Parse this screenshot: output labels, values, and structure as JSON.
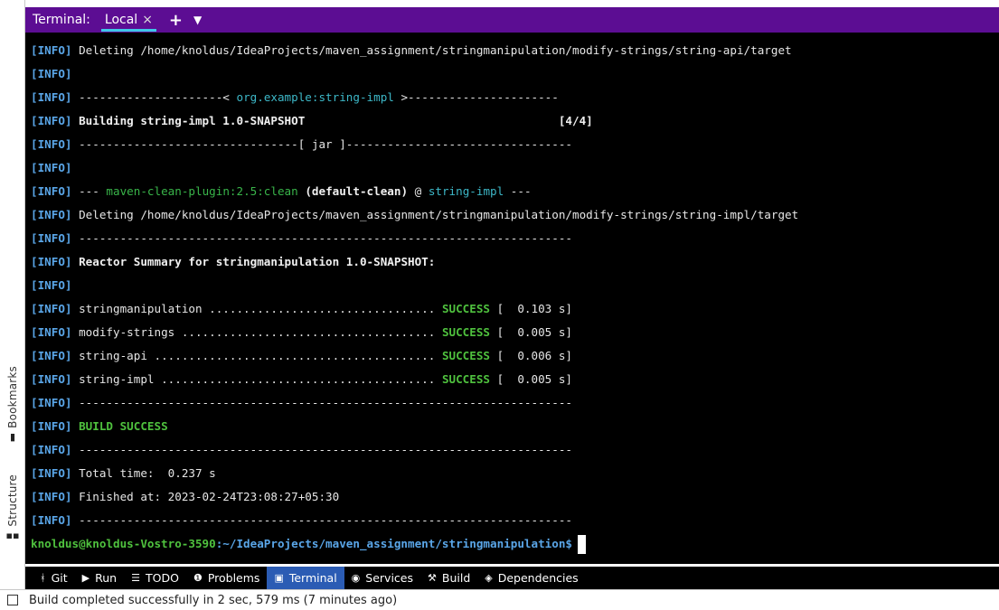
{
  "left_strip": {
    "bookmarks_label": "Bookmarks",
    "structure_label": "Structure"
  },
  "terminal": {
    "title": "Terminal:",
    "tab_label": "Local",
    "close_glyph": "×",
    "add_glyph": "+",
    "dropdown_glyph": "⌄"
  },
  "lines": [
    [
      {
        "t": "[INFO]",
        "c": "info"
      },
      {
        "t": " Deleting /home/knoldus/IdeaProjects/maven_assignment/stringmanipulation/modify-strings/string-api/target"
      }
    ],
    [
      {
        "t": "[INFO]",
        "c": "info"
      }
    ],
    [
      {
        "t": "[INFO]",
        "c": "info"
      },
      {
        "t": " ---------------------< "
      },
      {
        "t": "org.example:string-impl",
        "c": "art"
      },
      {
        "t": " >----------------------"
      }
    ],
    [
      {
        "t": "[INFO]",
        "c": "info"
      },
      {
        "t": " Building string-impl 1.0-SNAPSHOT                                     [4/4]",
        "c": "bold"
      }
    ],
    [
      {
        "t": "[INFO]",
        "c": "info"
      },
      {
        "t": " --------------------------------[ jar ]---------------------------------"
      }
    ],
    [
      {
        "t": "[INFO]",
        "c": "info"
      }
    ],
    [
      {
        "t": "[INFO]",
        "c": "info"
      },
      {
        "t": " --- "
      },
      {
        "t": "maven-clean-plugin:2.5:clean",
        "c": "plg"
      },
      {
        "t": " (default-clean)",
        "c": "bold"
      },
      {
        "t": " @ "
      },
      {
        "t": "string-impl",
        "c": "art"
      },
      {
        "t": " ---"
      }
    ],
    [
      {
        "t": "[INFO]",
        "c": "info"
      },
      {
        "t": " Deleting /home/knoldus/IdeaProjects/maven_assignment/stringmanipulation/modify-strings/string-impl/target"
      }
    ],
    [
      {
        "t": "[INFO]",
        "c": "info"
      },
      {
        "t": " ------------------------------------------------------------------------"
      }
    ],
    [
      {
        "t": "[INFO]",
        "c": "info"
      },
      {
        "t": " Reactor Summary for stringmanipulation 1.0-SNAPSHOT:",
        "c": "bold"
      }
    ],
    [
      {
        "t": "[INFO]",
        "c": "info"
      }
    ],
    [
      {
        "t": "[INFO]",
        "c": "info"
      },
      {
        "t": " stringmanipulation ................................. "
      },
      {
        "t": "SUCCESS",
        "c": "succ"
      },
      {
        "t": " [  0.103 s]"
      }
    ],
    [
      {
        "t": "[INFO]",
        "c": "info"
      },
      {
        "t": " modify-strings ..................................... "
      },
      {
        "t": "SUCCESS",
        "c": "succ"
      },
      {
        "t": " [  0.005 s]"
      }
    ],
    [
      {
        "t": "[INFO]",
        "c": "info"
      },
      {
        "t": " string-api ......................................... "
      },
      {
        "t": "SUCCESS",
        "c": "succ"
      },
      {
        "t": " [  0.006 s]"
      }
    ],
    [
      {
        "t": "[INFO]",
        "c": "info"
      },
      {
        "t": " string-impl ........................................ "
      },
      {
        "t": "SUCCESS",
        "c": "succ"
      },
      {
        "t": " [  0.005 s]"
      }
    ],
    [
      {
        "t": "[INFO]",
        "c": "info"
      },
      {
        "t": " ------------------------------------------------------------------------"
      }
    ],
    [
      {
        "t": "[INFO]",
        "c": "info"
      },
      {
        "t": " BUILD SUCCESS",
        "c": "bsucc"
      }
    ],
    [
      {
        "t": "[INFO]",
        "c": "info"
      },
      {
        "t": " ------------------------------------------------------------------------"
      }
    ],
    [
      {
        "t": "[INFO]",
        "c": "info"
      },
      {
        "t": " Total time:  0.237 s"
      }
    ],
    [
      {
        "t": "[INFO]",
        "c": "info"
      },
      {
        "t": " Finished at: 2023-02-24T23:08:27+05:30"
      }
    ],
    [
      {
        "t": "[INFO]",
        "c": "info"
      },
      {
        "t": " ------------------------------------------------------------------------"
      }
    ]
  ],
  "prompt": {
    "user_host": "knoldus@knoldus-Vostro-3590",
    "path": ":~/IdeaProjects/maven_assignment/stringmanipulation",
    "symbol": "$"
  },
  "tool_tabs": [
    {
      "label": "Git",
      "icon": "git-branch-icon",
      "glyph": "ᚼ",
      "active": false
    },
    {
      "label": "Run",
      "icon": "play-icon",
      "glyph": "▶",
      "active": false
    },
    {
      "label": "TODO",
      "icon": "list-icon",
      "glyph": "☰",
      "active": false
    },
    {
      "label": "Problems",
      "icon": "problems-icon",
      "glyph": "❶",
      "active": false
    },
    {
      "label": "Terminal",
      "icon": "terminal-icon",
      "glyph": "▣",
      "active": true
    },
    {
      "label": "Services",
      "icon": "services-icon",
      "glyph": "◉",
      "active": false
    },
    {
      "label": "Build",
      "icon": "hammer-icon",
      "glyph": "⚒",
      "active": false
    },
    {
      "label": "Dependencies",
      "icon": "dependencies-icon",
      "glyph": "◈",
      "active": false
    }
  ],
  "status": {
    "message": "Build completed successfully in 2 sec, 579 ms (7 minutes ago)"
  }
}
